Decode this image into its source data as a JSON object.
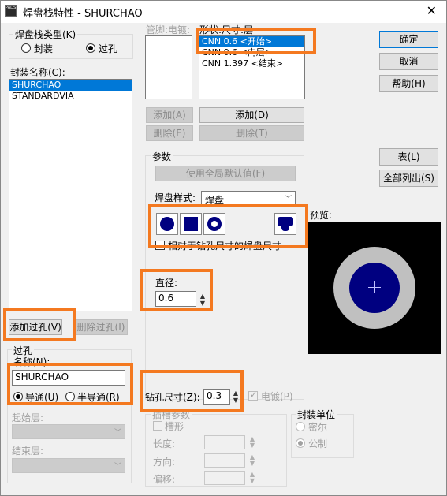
{
  "window": {
    "title": "焊盘栈特性 - SHURCHAO",
    "icon_text": "PADS"
  },
  "pad_stack_type": {
    "group_label": "焊盘栈类型(K)",
    "options": [
      "封装",
      "过孔"
    ],
    "selected": "过孔"
  },
  "package_names": {
    "label": "封装名称(C):",
    "items": [
      "SHURCHAO",
      "STANDARDVIA"
    ],
    "selected_index": 0
  },
  "pin_list": {
    "label": "管脚:电镀:"
  },
  "layer_list": {
    "label": "形状:尺寸:层",
    "items": [
      "CNN 0.6 <开始>",
      "CNN 0.6 <内层>",
      "CNN 1.397 <结束>"
    ],
    "selected_index": 0
  },
  "buttons": {
    "ok": "确定",
    "cancel": "取消",
    "help": "帮助(H)",
    "add_left": "添加(A)",
    "delete_left": "删除(E)",
    "add_right": "添加(D)",
    "delete_right": "删除(T)",
    "table": "表(L)",
    "list_all": "全部列出(S)",
    "add_via": "添加过孔(V)",
    "delete_via": "删除过孔(I)",
    "use_global_defaults": "使用全局默认值(F)"
  },
  "params": {
    "group_label": "参数",
    "pad_style_label": "焊盘样式:",
    "pad_style_value": "焊盘",
    "relative_checkbox": "相对于钻孔尺寸的焊盘尺寸",
    "diameter_label": "直径:",
    "diameter_value": "0.6"
  },
  "preview": {
    "label": "预览:",
    "outer_color": "#c0c0c0",
    "inner_color": "#000080",
    "background": "#000000"
  },
  "via": {
    "group_label": "过孔",
    "name_label": "名称(N):",
    "name_value": "SHURCHAO",
    "options": [
      "导通(U)",
      "半导通(R)"
    ],
    "selected": "导通(U)",
    "start_layer_label": "起始层:",
    "end_layer_label": "结束层:"
  },
  "drill": {
    "label": "钻孔尺寸(Z):",
    "value": "0.3",
    "plated_label": "电镀(P)",
    "plated_checked": true
  },
  "slot": {
    "group_label": "插槽参数",
    "slot_checkbox": "槽形",
    "length_label": "长度:",
    "direction_label": "方向:",
    "offset_label": "偏移:"
  },
  "units": {
    "group_label": "封装单位",
    "options": [
      "密尔",
      "公制"
    ],
    "selected": "公制"
  },
  "colors": {
    "highlight": "#f47920",
    "selection": "#0078d7"
  }
}
